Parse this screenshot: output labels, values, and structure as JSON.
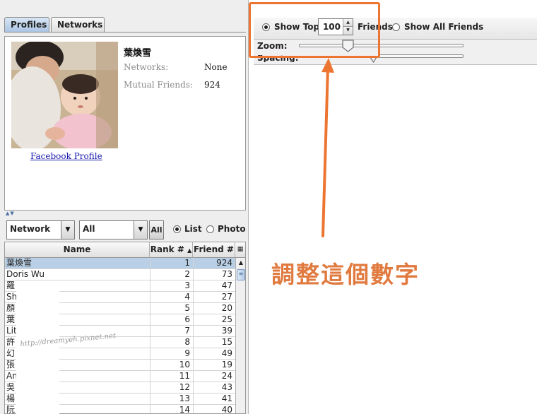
{
  "left_panel": {
    "tabs": [
      {
        "label": "Profiles"
      },
      {
        "label": "Networks"
      }
    ],
    "profile": {
      "name": "葉煥雪",
      "networks_label": "Networks:",
      "networks_value": "None",
      "mutual_label": "Mutual Friends:",
      "mutual_value": "924",
      "link_label": "Facebook Profile"
    },
    "filters": {
      "network_combo": "Network",
      "filter_combo": "All",
      "all_button": "All",
      "list_label": "List",
      "photo_label": "Photo",
      "view_selected": "List"
    },
    "table": {
      "columns": [
        "Name",
        "Rank #",
        "Friend #"
      ],
      "rows": [
        {
          "name": "葉煥雪",
          "rank": "1",
          "friends": "924"
        },
        {
          "name": "Doris Wu",
          "rank": "2",
          "friends": "73"
        },
        {
          "name": "羅",
          "rank": "3",
          "friends": "47"
        },
        {
          "name": "Sh                       i",
          "rank": "4",
          "friends": "27"
        },
        {
          "name": "顏",
          "rank": "5",
          "friends": "20"
        },
        {
          "name": "葉",
          "rank": "6",
          "friends": "25"
        },
        {
          "name": "Lit",
          "rank": "7",
          "friends": "39"
        },
        {
          "name": "許",
          "rank": "8",
          "friends": "15"
        },
        {
          "name": "幻",
          "rank": "9",
          "friends": "49"
        },
        {
          "name": "張",
          "rank": "10",
          "friends": "19"
        },
        {
          "name": "An",
          "rank": "11",
          "friends": "24"
        },
        {
          "name": "吳",
          "rank": "12",
          "friends": "43"
        },
        {
          "name": "楊",
          "rank": "13",
          "friends": "41"
        },
        {
          "name": "阮",
          "rank": "14",
          "friends": "40"
        }
      ]
    },
    "watermark": "http://dreamyeh.pixnet.net"
  },
  "right_panel": {
    "show_top_label": "Show Top",
    "show_top_value": "100",
    "friends_label": "Friends",
    "show_all_label": "Show All Friends",
    "zoom_label": "Zoom:",
    "zoom_level": 0.3,
    "spacing_label": "Spacing:"
  },
  "annotation": {
    "text": "調整這個數字",
    "color": "#e07a3f"
  },
  "colors": {
    "highlight": "#ec7532",
    "selected_row": "#b8cfe5",
    "link": "#1a1ab0"
  }
}
